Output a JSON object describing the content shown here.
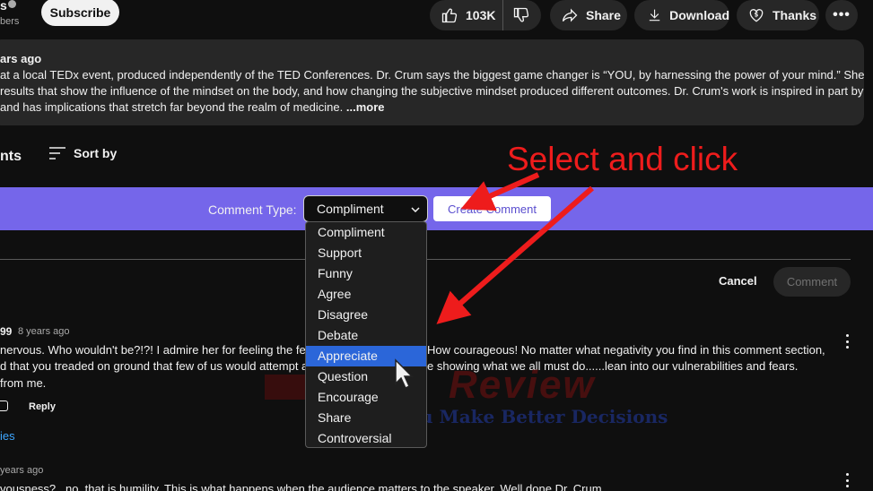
{
  "channel": {
    "name_fragment": "s",
    "subs_fragment": "bers",
    "subscribe_label": "Subscribe"
  },
  "actions": {
    "like_count": "103K",
    "share": "Share",
    "download": "Download",
    "thanks": "Thanks"
  },
  "description": {
    "date_fragment": "ars ago",
    "lines": [
      "at a local TEDx event, produced independently of the TED Conferences. Dr. Crum says the biggest game changer is “YOU, by harnessing the power of your mind.” She",
      "results that show the influence of the mindset on the body, and how changing the subjective mindset produced different outcomes. Dr. Crum's work is inspired in part by",
      "and has implications that stretch far beyond the realm of medicine. "
    ],
    "more": "...more"
  },
  "comments_header": {
    "title_fragment": "nts",
    "sort_label": "Sort by"
  },
  "annotation": {
    "text": "Select and click",
    "color": "#ee1c1c"
  },
  "toolbar": {
    "comment_type_label": "Comment Type:",
    "selected": "Compliment",
    "create_button": "Create Comment",
    "accent": "#7566ea"
  },
  "dropdown": {
    "options": [
      "Compliment",
      "Support",
      "Funny",
      "Agree",
      "Disagree",
      "Debate",
      "Appreciate",
      "Question",
      "Encourage",
      "Share",
      "Controversial"
    ],
    "highlighted": "Appreciate"
  },
  "composer": {
    "cancel": "Cancel",
    "comment": "Comment"
  },
  "comment1": {
    "author_fragment": "99",
    "time": "8 years ago",
    "line1a": "nervous.  Who wouldn't be?!?!  I admire her for feeling the fea",
    "line1b": "How courageous!  No matter what negativity you find in this comment section,",
    "line2a": "d that you treaded on ground that few of us would attempt an",
    "line2b": "e showing what we all must do......lean into our vulnerabilities and fears.",
    "line3": "from me.",
    "reply": "Reply",
    "replies_fragment": "ies"
  },
  "comment2": {
    "time_fragment": "years ago",
    "line1": "vousness?...no, that is humility.  This is what happens when the audience matters to the speaker.  Well done Dr. Crum."
  },
  "watermark": {
    "brand": "Review",
    "tagline": "Help You Make Better Decisions"
  }
}
